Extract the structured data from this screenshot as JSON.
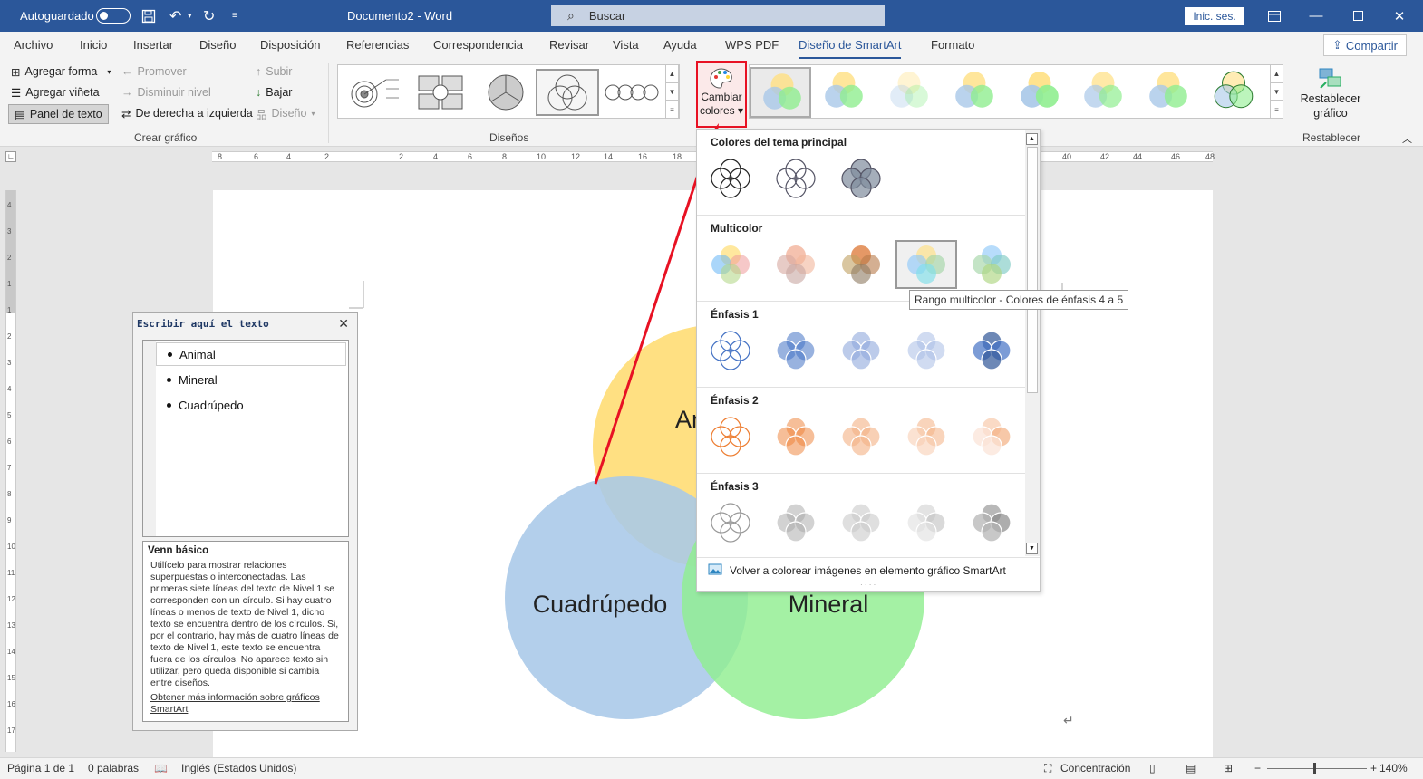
{
  "titlebar": {
    "autosave_label": "Autoguardado",
    "doc_title": "Documento2  -  Word",
    "search_placeholder": "Buscar",
    "signin": "Inic. ses."
  },
  "tabs": [
    "Archivo",
    "Inicio",
    "Insertar",
    "Diseño",
    "Disposición",
    "Referencias",
    "Correspondencia",
    "Revisar",
    "Vista",
    "Ayuda",
    "WPS PDF",
    "Diseño de SmartArt",
    "Formato"
  ],
  "active_tab": "Diseño de SmartArt",
  "share_label": "Compartir",
  "ribbon": {
    "create": {
      "add_shape": "Agregar forma",
      "add_bullet": "Agregar viñeta",
      "text_pane": "Panel de texto",
      "promote": "Promover",
      "demote": "Disminuir nivel",
      "rtl": "De derecha a izquierda",
      "move_up": "Subir",
      "move_down": "Bajar",
      "layout": "Diseño",
      "group_label": "Crear gráfico"
    },
    "layouts_label": "Diseños",
    "change_colors": [
      "Cambiar",
      "colores"
    ],
    "reset": {
      "label1": "Restablecer",
      "label2": "gráfico",
      "group_label": "Restablecer"
    }
  },
  "text_pane": {
    "title": "Escribir aquí el texto",
    "items": [
      "Animal",
      "Mineral",
      "Cuadrúpedo"
    ],
    "desc_title": "Venn básico",
    "desc_body": "Utilícelo para mostrar relaciones superpuestas o interconectadas. Las primeras siete líneas del texto de Nivel 1 se corresponden con un círculo. Si hay cuatro líneas o menos de texto de Nivel 1, dicho texto se encuentra dentro de los círculos. Si, por el contrario, hay más de cuatro líneas de texto de Nivel 1, este texto se encuentra fuera de los círculos. No aparece texto sin utilizar, pero queda disponible si cambia entre diseños.",
    "desc_link": "Obtener más información sobre gráficos SmartArt"
  },
  "diagram": {
    "labels": {
      "top": "Animal",
      "left": "Cuadrúpedo",
      "right": "Mineral"
    },
    "colors": {
      "top": "#ffe082",
      "left": "#a9c8e8",
      "right": "#90ee90"
    }
  },
  "dropdown": {
    "sections": [
      "Colores del tema principal",
      "Multicolor",
      "Énfasis 1",
      "Énfasis 2",
      "Énfasis 3"
    ],
    "recolor": "Volver a colorear imágenes en elemento gráfico SmartArt",
    "tooltip": "Rango multicolor - Colores de énfasis 4 a 5"
  },
  "status": {
    "page": "Página 1 de 1",
    "words": "0 palabras",
    "language": "Inglés (Estados Unidos)",
    "focus": "Concentración",
    "zoom": "140%"
  },
  "ruler_marks": [
    "8",
    "6",
    "4",
    "2",
    "2",
    "4",
    "6",
    "8",
    "10",
    "12",
    "14",
    "16",
    "18",
    "40",
    "42",
    "44",
    "46",
    "48"
  ],
  "vruler_marks": [
    "4",
    "3",
    "2",
    "1",
    "1",
    "2",
    "3",
    "4",
    "5",
    "6",
    "7",
    "8",
    "9",
    "10",
    "11",
    "12",
    "13",
    "14",
    "15",
    "16",
    "17"
  ]
}
